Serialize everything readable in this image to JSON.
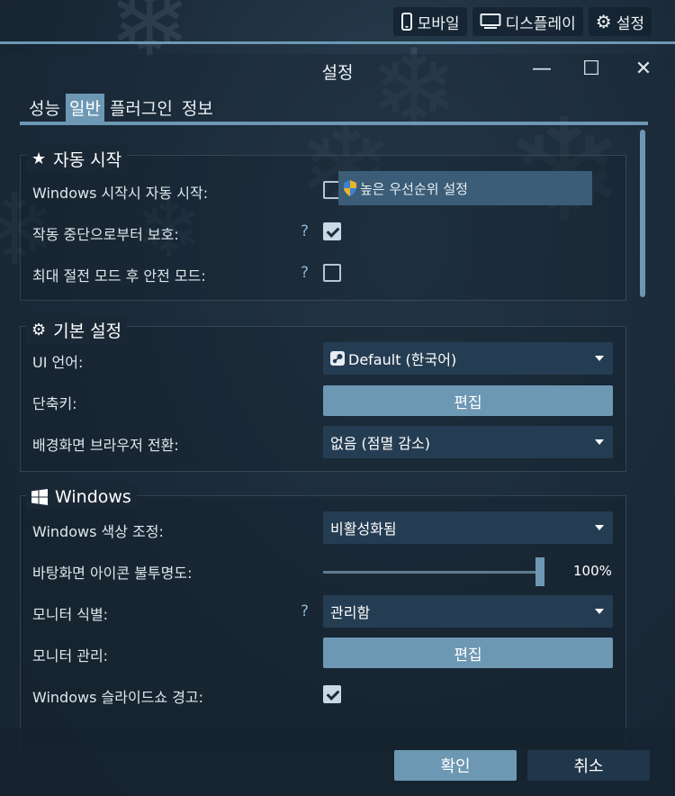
{
  "topbar": {
    "mobile_label": "모바일",
    "display_label": "디스플레이",
    "settings_label": "설정"
  },
  "window": {
    "title": "설정",
    "minimize": "—",
    "maximize": "☐",
    "close": "✕"
  },
  "tabs": [
    {
      "label": "성능",
      "active": false
    },
    {
      "label": "일반",
      "active": true
    },
    {
      "label": "플러그인",
      "active": false
    },
    {
      "label": "정보",
      "active": false
    }
  ],
  "autostart": {
    "header": "자동 시작",
    "row1_label": "Windows 시작시 자동 시작:",
    "row1_checked": false,
    "priority_button": "높은 우선순위 설정",
    "row2_label": "작동 중단으로부터 보호:",
    "row2_help": "?",
    "row2_checked": true,
    "row3_label": "최대 절전 모드 후 안전 모드:",
    "row3_help": "?",
    "row3_checked": false
  },
  "basic": {
    "header": "기본 설정",
    "ui_lang_label": "UI 언어:",
    "ui_lang_value": "Default (한국어)",
    "shortcut_label": "단축키:",
    "shortcut_button": "편집",
    "bg_switch_label": "배경화면 브라우저 전환:",
    "bg_switch_value": "없음 (점멸 감소)"
  },
  "windows": {
    "header": "Windows",
    "color_label": "Windows 색상 조정:",
    "color_value": "비활성화됨",
    "icon_opacity_label": "바탕화면 아이콘 불투명도:",
    "icon_opacity_value": "100%",
    "icon_opacity_fraction": 1.0,
    "monitor_id_label": "모니터 식별:",
    "monitor_id_help": "?",
    "monitor_id_value": "관리함",
    "monitor_mgmt_label": "모니터 관리:",
    "monitor_mgmt_button": "편집",
    "slideshow_label": "Windows 슬라이드쇼 경고:",
    "slideshow_checked": true
  },
  "footer": {
    "ok": "확인",
    "cancel": "취소"
  },
  "colors": {
    "accent": "#6d98b4",
    "dropdown": "#253d52",
    "background": "#1b2a38"
  }
}
